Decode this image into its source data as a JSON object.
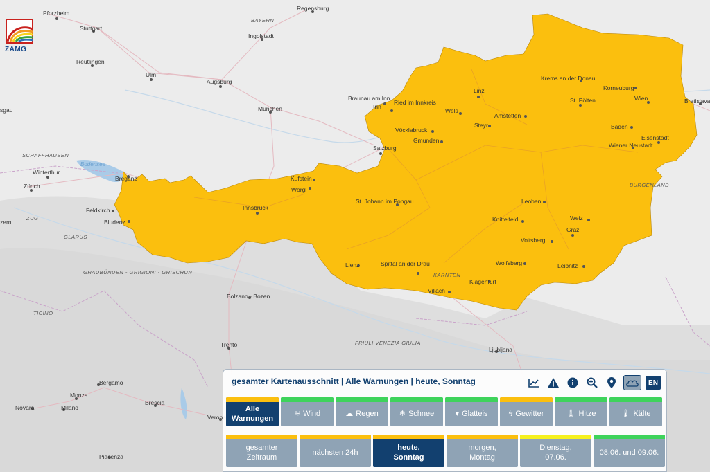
{
  "header": {
    "title": "gesamter Kartenausschnitt | Alle Warnungen | heute, Sonntag",
    "language": "EN"
  },
  "logo": {
    "text": "ZAMG"
  },
  "colors": {
    "warning_yellow": "#fbbf0e",
    "green": "#3ed35b",
    "light_yellow": "#f5f01e",
    "active": "#12406f",
    "inactive": "#8fa3b5"
  },
  "tools": [
    {
      "name": "chart-icon"
    },
    {
      "name": "warning-icon"
    },
    {
      "name": "info-icon"
    },
    {
      "name": "zoom-icon"
    },
    {
      "name": "location-pin-icon"
    },
    {
      "name": "cloud-icon"
    }
  ],
  "categories": [
    {
      "label": "Alle Warnungen",
      "icon": "",
      "color": "#fbbf0e",
      "active": true
    },
    {
      "label": "Wind",
      "icon": "wind-icon",
      "color": "#3ed35b",
      "active": false
    },
    {
      "label": "Regen",
      "icon": "rain-icon",
      "color": "#3ed35b",
      "active": false
    },
    {
      "label": "Schnee",
      "icon": "snowflake-icon",
      "color": "#3ed35b",
      "active": false
    },
    {
      "label": "Glatteis",
      "icon": "icicle-icon",
      "color": "#3ed35b",
      "active": false
    },
    {
      "label": "Gewitter",
      "icon": "lightning-icon",
      "color": "#fbbf0e",
      "active": false
    },
    {
      "label": "Hitze",
      "icon": "thermometer-hot-icon",
      "color": "#3ed35b",
      "active": false
    },
    {
      "label": "Kälte",
      "icon": "thermometer-cold-icon",
      "color": "#3ed35b",
      "active": false
    }
  ],
  "periods": [
    {
      "label": "gesamter Zeitraum",
      "color": "#fbbf0e",
      "active": false
    },
    {
      "label": "nächsten 24h",
      "color": "#fbbf0e",
      "active": false
    },
    {
      "label": "heute, Sonntag",
      "color": "#fbbf0e",
      "active": true
    },
    {
      "label": "morgen, Montag",
      "color": "#fbbf0e",
      "active": false
    },
    {
      "label": "Dienstag, 07.06.",
      "color": "#f5f01e",
      "active": false
    },
    {
      "label": "08.06. und 09.06.",
      "color": "#3ed35b",
      "active": false
    }
  ],
  "map": {
    "regions": [
      "BAYERN",
      "SCHAFFHAUSEN",
      "GLARUS",
      "ZUG",
      "GRAUBÜNDEN - GRIGIONI - GRISCHUN",
      "TICINO",
      "FRIULI VENEZIA GIULIA",
      "KÄRNTEN",
      "BURGENLAND"
    ],
    "lake": "Bodensee",
    "cities_outside": [
      "Pforzheim",
      "Stuttgart",
      "Reutlingen",
      "Ulm",
      "Augsburg",
      "Ingolstadt",
      "Regensburg",
      "München",
      "Winterthur",
      "Zürich",
      "Bregenz",
      "Feldkirch",
      "Bludenz",
      "Bolzano - Bozen",
      "Trento",
      "Bergamo",
      "Monza",
      "Milano",
      "Novara",
      "Brescia",
      "Verona",
      "Piacenza",
      "Ljubljana",
      "Bratislava",
      "sgau",
      "zern"
    ],
    "cities_inside": [
      "Braunau am Inn",
      "Ried im Innkreis",
      "Linz",
      "Wels",
      "Vöcklabruck",
      "Gmunden",
      "Steyr",
      "Amstetten",
      "Krems an der Donau",
      "Korneuburg",
      "St. Pölten",
      "Wien",
      "Baden",
      "Eisenstadt",
      "Wiener Neustadt",
      "Salzburg",
      "Kufstein",
      "Wörgl",
      "Innsbruck",
      "St. Johann im Pongau",
      "Leoben",
      "Knittelfeld",
      "Weiz",
      "Graz",
      "Voitsberg",
      "Wolfsberg",
      "Leibnitz",
      "Lienz",
      "Spittal an der Drau",
      "Klagenfurt",
      "Villach"
    ]
  }
}
